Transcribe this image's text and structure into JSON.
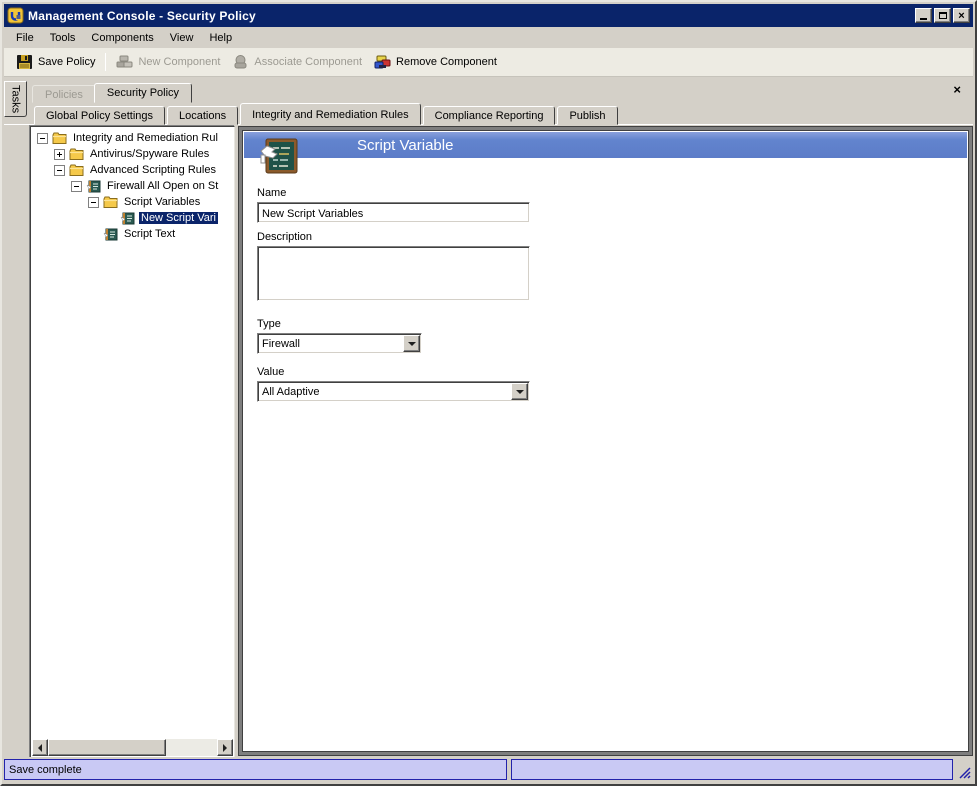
{
  "window": {
    "title": "Management Console - Security Policy"
  },
  "menu": {
    "items": [
      {
        "label": "File"
      },
      {
        "label": "Tools"
      },
      {
        "label": "Components"
      },
      {
        "label": "View"
      },
      {
        "label": "Help"
      }
    ]
  },
  "toolbar": {
    "buttons": [
      {
        "label": "Save Policy",
        "enabled": true
      },
      {
        "label": "New Component",
        "enabled": false
      },
      {
        "label": "Associate Component",
        "enabled": false
      },
      {
        "label": "Remove Component",
        "enabled": true
      }
    ]
  },
  "tasks_tab": {
    "label": "Tasks"
  },
  "primary_tabs": [
    {
      "label": "Policies",
      "active": false,
      "disabled": true
    },
    {
      "label": "Security Policy",
      "active": true
    }
  ],
  "secondary_tabs": [
    {
      "label": "Global Policy Settings",
      "active": false
    },
    {
      "label": "Locations",
      "active": false
    },
    {
      "label": "Integrity and Remediation Rules",
      "active": true
    },
    {
      "label": "Compliance Reporting",
      "active": false
    },
    {
      "label": "Publish",
      "active": false
    }
  ],
  "tree": {
    "items": [
      {
        "label": "Integrity and Remediation Rul",
        "level": 0,
        "expander": "minus",
        "icon": "folder",
        "selected": false
      },
      {
        "label": "Antivirus/Spyware Rules",
        "level": 1,
        "expander": "plus",
        "icon": "folder",
        "selected": false
      },
      {
        "label": "Advanced Scripting Rules",
        "level": 1,
        "expander": "minus",
        "icon": "folder",
        "selected": false
      },
      {
        "label": "Firewall All Open on St",
        "level": 2,
        "expander": "minus",
        "icon": "script",
        "selected": false
      },
      {
        "label": "Script Variables",
        "level": 3,
        "expander": "minus",
        "icon": "folder",
        "selected": false
      },
      {
        "label": "New Script Vari",
        "level": 4,
        "expander": "none",
        "icon": "script",
        "selected": true
      },
      {
        "label": "Script Text",
        "level": 3,
        "expander": "none",
        "icon": "script",
        "selected": false
      }
    ]
  },
  "detail": {
    "header": {
      "title": "Script Variable"
    },
    "fields": {
      "name": {
        "label": "Name",
        "value": "New Script Variables"
      },
      "description": {
        "label": "Description",
        "value": ""
      },
      "type": {
        "label": "Type",
        "value": "Firewall"
      },
      "value": {
        "label": "Value",
        "value": "All Adaptive"
      }
    }
  },
  "status_bar": {
    "left_message": "Save complete",
    "right_message": ""
  },
  "colors": {
    "titlebar": "#0A246A",
    "banner_top": "#8AA0DC",
    "banner_bottom": "#5C7CC8",
    "selection": "#0A246A",
    "status_bg": "#C9C9F4",
    "status_border": "#2323AB",
    "window_bg": "#D4D0C8"
  }
}
